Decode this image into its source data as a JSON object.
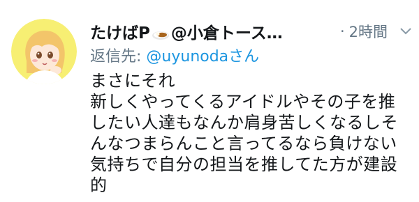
{
  "tweet": {
    "display_name_text": "たけばP",
    "display_name_suffix": "@小倉トース…",
    "name_emoji_icon": "curry-rice-icon",
    "timestamp": "2時間",
    "reply_prefix": "返信先: ",
    "reply_to": "@uyunodaさん",
    "lines": [
      "まさにそれ",
      "新しくやってくるアイドルやその子を推",
      "したい人達もなんか肩身苦しくなるしそ",
      "んなつまらんこと言ってるなら負けない",
      "気持ちで自分の担当を推してた方が建設",
      "的"
    ]
  },
  "colors": {
    "text": "#14171a",
    "secondary": "#657786",
    "link": "#1b95e0",
    "avatar_bg": "#f7ef73"
  }
}
